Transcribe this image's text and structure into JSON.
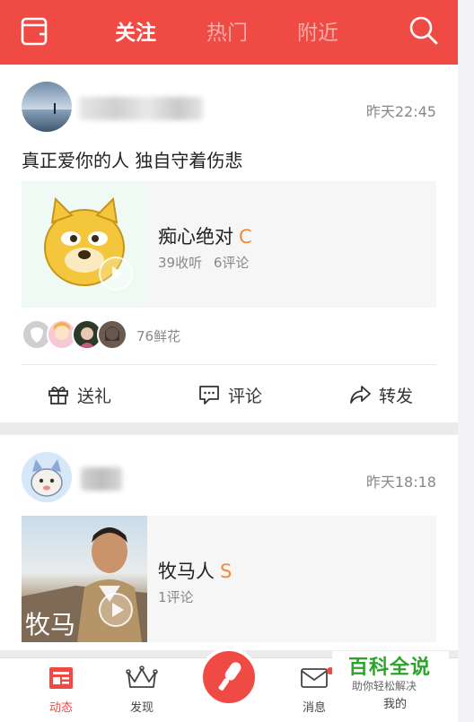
{
  "header": {
    "tabs": [
      {
        "label": "关注",
        "active": true
      },
      {
        "label": "热门",
        "active": false
      },
      {
        "label": "附近",
        "active": false
      }
    ],
    "left_icon": "book-icon",
    "right_icon": "search-icon",
    "bg_color": "#ef4a44"
  },
  "feed": [
    {
      "time": "昨天22:45",
      "text": "真正爱你的人 独自守着伤悲",
      "song": {
        "title": "痴心绝对",
        "grade": "C",
        "listens": "39收听",
        "comments": "6评论"
      },
      "flowers": "76鲜花",
      "actions": {
        "gift": "送礼",
        "comment": "评论",
        "share": "转发"
      }
    },
    {
      "time": "昨天18:18",
      "song": {
        "title": "牧马人",
        "grade": "S",
        "comments": "1评论",
        "cover_text": "牧马"
      }
    }
  ],
  "bottom_nav": {
    "items": [
      {
        "label": "动态",
        "active": true
      },
      {
        "label": "发现",
        "active": false
      },
      {
        "label": "消息",
        "active": false
      },
      {
        "label": "我的",
        "active": false
      }
    ]
  },
  "watermark": {
    "title": "百科全说",
    "subtitle": "助你轻松解决"
  }
}
